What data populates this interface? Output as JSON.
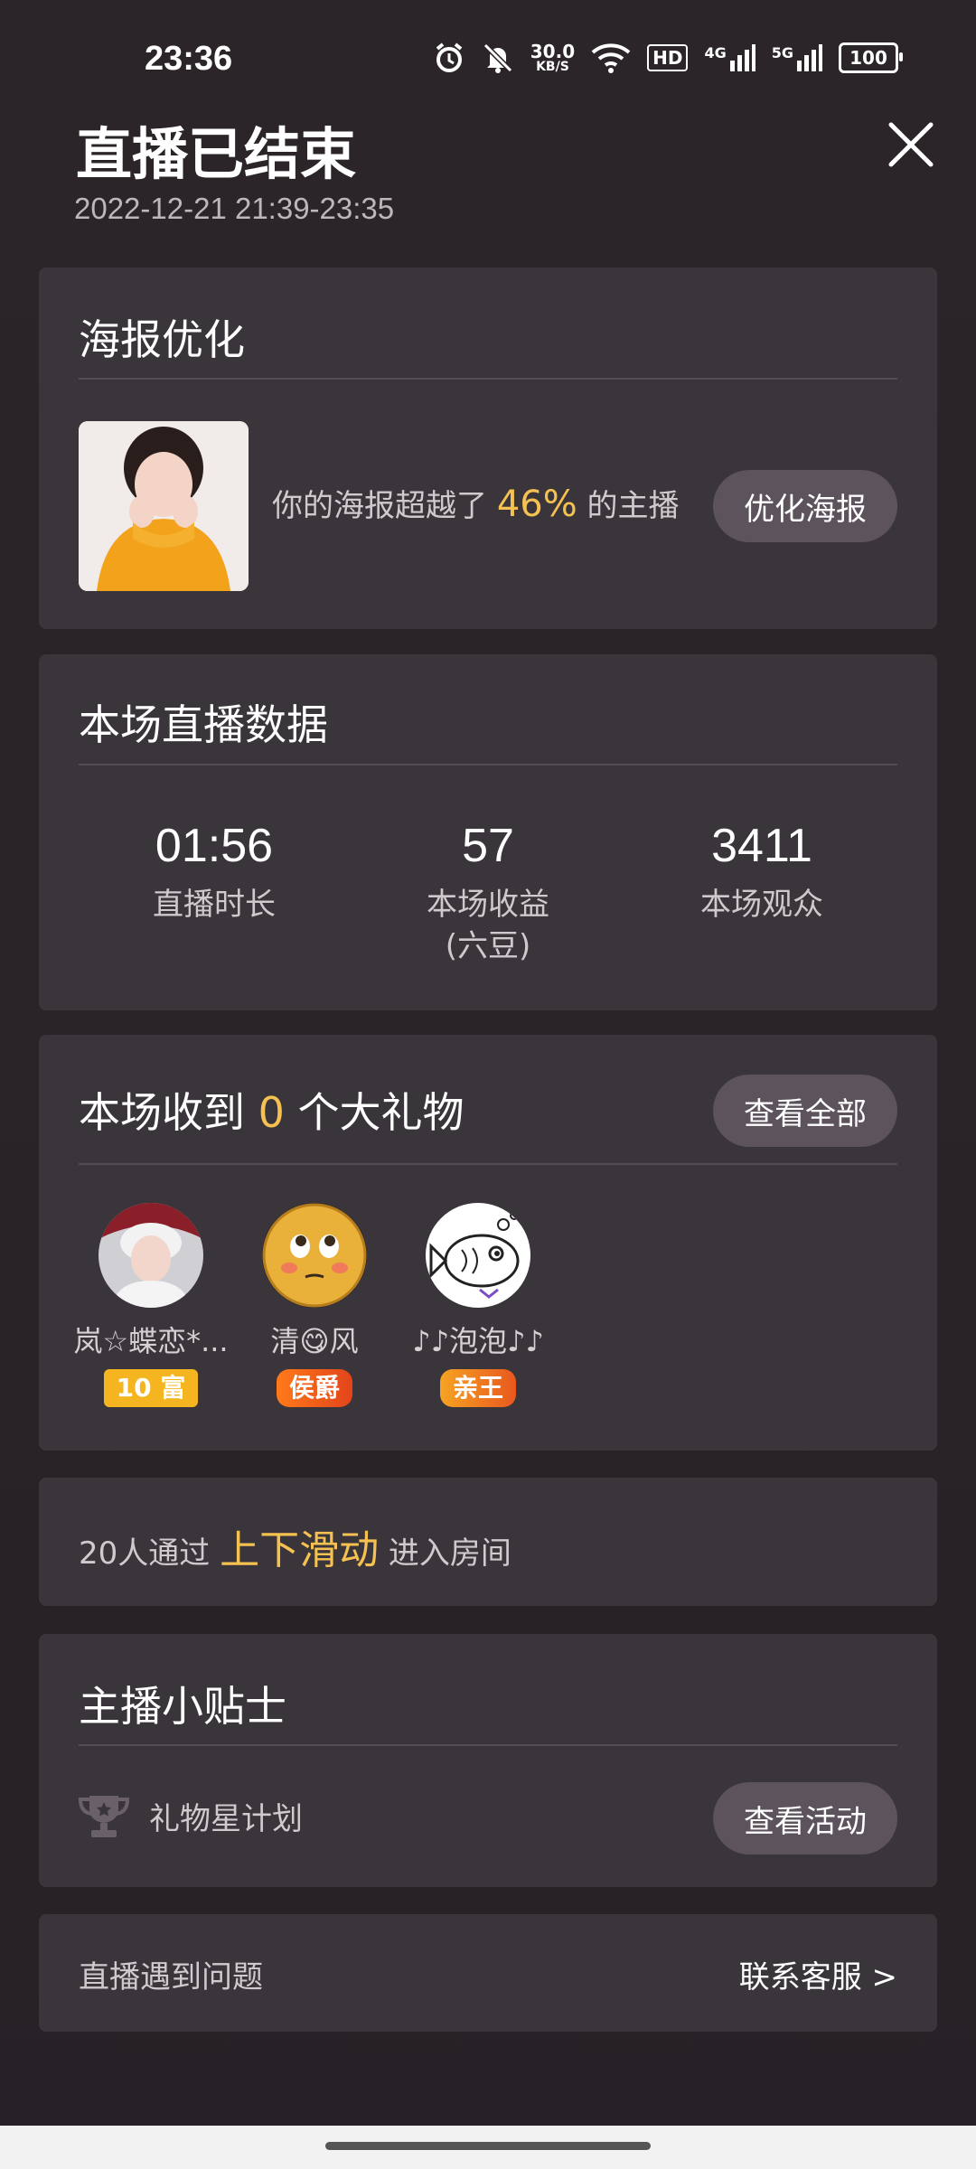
{
  "status_bar": {
    "time": "23:36",
    "net_speed_value": "30.0",
    "net_speed_unit": "KB/S",
    "hd_label": "HD",
    "signal1_label": "4G",
    "signal2_label": "5G",
    "battery": "100",
    "icons": [
      "alarm-icon",
      "mute-icon",
      "wifi-icon",
      "hd-icon",
      "signal-4g-icon",
      "signal-5g-icon",
      "battery-icon"
    ]
  },
  "header": {
    "title": "直播已结束",
    "time_range": "2022-12-21 21:39-23:35"
  },
  "poster": {
    "title": "海报优化",
    "text_before": "你的海报超越了",
    "percent": "46%",
    "text_after": "的主播",
    "button": "优化海报"
  },
  "stats": {
    "title": "本场直播数据",
    "items": [
      {
        "value": "01:56",
        "label": "直播时长"
      },
      {
        "value": "57",
        "label": "本场收益",
        "sublabel": "(六豆)"
      },
      {
        "value": "3411",
        "label": "本场观众"
      }
    ]
  },
  "gifts": {
    "title_before": "本场收到",
    "count": "0",
    "title_after": "个大礼物",
    "button": "查看全部",
    "gifters": [
      {
        "name": "岚☆蝶恋*...",
        "badge": "10 富"
      },
      {
        "name": "清😋风",
        "badge": "侯爵"
      },
      {
        "name": "♪♪泡泡♪♪",
        "badge": "亲王"
      }
    ]
  },
  "swipe": {
    "text_before": "20人通过",
    "highlight": "上下滑动",
    "text_after": "进入房间"
  },
  "tips": {
    "title": "主播小贴士",
    "item_label": "礼物星计划",
    "button": "查看活动"
  },
  "problem": {
    "text": "直播遇到问题",
    "link": "联系客服 >"
  },
  "colors": {
    "accent": "#f5c150",
    "card": "#3a343b",
    "pill": "#5c535d"
  }
}
